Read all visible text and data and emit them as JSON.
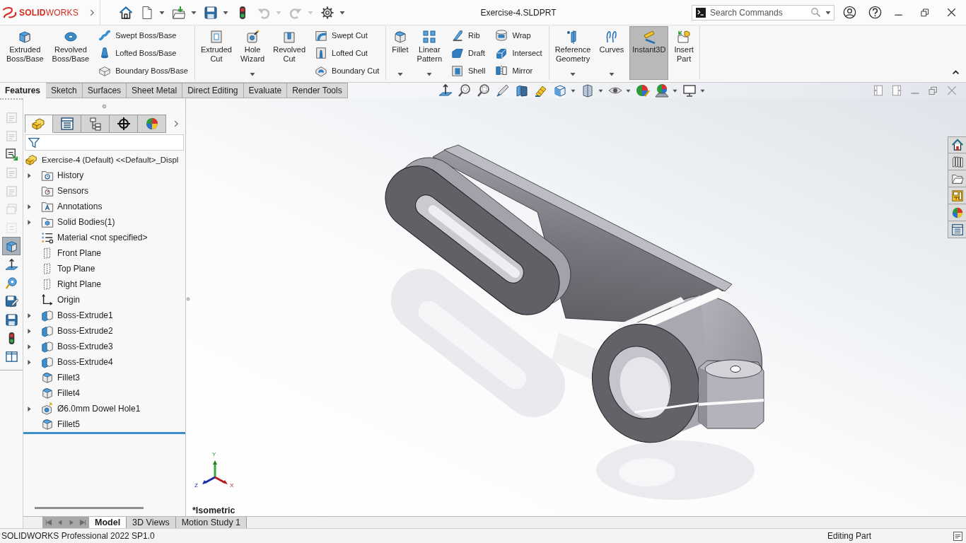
{
  "app": {
    "logo": "**SOLID**WORKS"
  },
  "quick_access": [
    {
      "dropdown": false,
      "disabled": false
    },
    {
      "dropdown": true,
      "disabled": false
    },
    {
      "dropdown": true,
      "disabled": false
    },
    {
      "dropdown": true,
      "disabled": false
    },
    {
      "dropdown": false,
      "disabled": false
    },
    {
      "dropdown": true,
      "disabled": true
    },
    {
      "dropdown": true,
      "disabled": true
    },
    {
      "dropdown": true,
      "disabled": false
    }
  ],
  "window": {
    "title": "Exercise-4.SLDPRT"
  },
  "search": {
    "placeholder": "Search Commands"
  },
  "ribbon": {
    "groups": [
      {
        "items": [
          {
            "kind": "large",
            "label": "Extruded Boss/Base",
            "dropdown": false,
            "selected": false
          },
          {
            "kind": "large",
            "label": "Revolved Boss/Base",
            "dropdown": false,
            "selected": false
          },
          {
            "kind": "column",
            "items": [
              {
                "label": "Swept Boss/Base"
              },
              {
                "label": "Lofted Boss/Base"
              },
              {
                "label": "Boundary Boss/Base"
              }
            ]
          }
        ]
      },
      {
        "items": [
          {
            "kind": "large",
            "label": "Extruded Cut",
            "dropdown": false,
            "selected": false
          },
          {
            "kind": "large",
            "label": "Hole Wizard",
            "dropdown": true,
            "selected": false
          },
          {
            "kind": "large",
            "label": "Revolved Cut",
            "dropdown": false,
            "selected": false
          },
          {
            "kind": "column",
            "items": [
              {
                "label": "Swept Cut"
              },
              {
                "label": "Lofted Cut"
              },
              {
                "label": "Boundary Cut"
              }
            ]
          }
        ]
      },
      {
        "items": [
          {
            "kind": "large",
            "label": "Fillet",
            "dropdown": true,
            "selected": false
          },
          {
            "kind": "large",
            "label": "Linear Pattern",
            "dropdown": true,
            "selected": false
          },
          {
            "kind": "column",
            "items": [
              {
                "label": "Rib"
              },
              {
                "label": "Draft"
              },
              {
                "label": "Shell"
              }
            ]
          },
          {
            "kind": "column",
            "items": [
              {
                "label": "Wrap"
              },
              {
                "label": "Intersect"
              },
              {
                "label": "Mirror"
              }
            ]
          }
        ]
      },
      {
        "items": [
          {
            "kind": "large",
            "label": "Reference Geometry",
            "dropdown": true,
            "selected": false
          },
          {
            "kind": "large",
            "label": "Curves",
            "dropdown": true,
            "selected": false
          },
          {
            "kind": "large",
            "label": "Instant3D",
            "dropdown": false,
            "selected": true
          },
          {
            "kind": "large",
            "label": "Insert Part",
            "dropdown": false,
            "selected": false
          }
        ]
      }
    ]
  },
  "command_tabs": [
    {
      "label": "Features",
      "selected": true
    },
    {
      "label": "Sketch",
      "selected": false
    },
    {
      "label": "Surfaces",
      "selected": false
    },
    {
      "label": "Sheet Metal",
      "selected": false
    },
    {
      "label": "Direct Editing",
      "selected": false
    },
    {
      "label": "Evaluate",
      "selected": false
    },
    {
      "label": "Render Tools",
      "selected": false
    }
  ],
  "heads_up_toolbar": [
    {
      "dropdown": false
    },
    {
      "dropdown": false
    },
    {
      "dropdown": false
    },
    {
      "dropdown": false
    },
    {
      "dropdown": false
    },
    {
      "dropdown": false
    },
    {
      "dropdown": true
    },
    {
      "dropdown": true
    },
    {
      "dropdown": true
    },
    {
      "dropdown": false
    },
    {
      "dropdown": true
    },
    {
      "dropdown": true
    }
  ],
  "left_toolbar": [
    {
      "disabled": true,
      "selected": false
    },
    {
      "disabled": true,
      "selected": false
    },
    {
      "disabled": false,
      "selected": false
    },
    {
      "disabled": true,
      "selected": false
    },
    {
      "disabled": true,
      "selected": false
    },
    {
      "disabled": true,
      "selected": false
    },
    {
      "disabled": true,
      "selected": false
    },
    {
      "disabled": false,
      "selected": true
    },
    {
      "disabled": false,
      "selected": false
    },
    {
      "disabled": false,
      "selected": false
    },
    {
      "disabled": false,
      "selected": false
    },
    {
      "disabled": false,
      "selected": false
    },
    {
      "disabled": false,
      "selected": false
    },
    {
      "disabled": false,
      "selected": false
    }
  ],
  "feature_manager": {
    "tabs": [
      {
        "selected": true
      },
      {
        "selected": false
      },
      {
        "selected": false
      },
      {
        "selected": false
      },
      {
        "selected": false
      }
    ],
    "tree": {
      "label": "Exercise-4 (Default) <<Default>_Displ",
      "kind": "part",
      "children": [
        {
          "label": "History",
          "kind": "history",
          "expanded": false
        },
        {
          "label": "Sensors",
          "kind": "sensors"
        },
        {
          "label": "Annotations",
          "kind": "annotations",
          "expanded": false
        },
        {
          "label": "Solid Bodies(1)",
          "kind": "bodies",
          "expanded": false
        },
        {
          "label": "Material <not specified>",
          "kind": "material"
        },
        {
          "label": "Front Plane",
          "kind": "plane"
        },
        {
          "label": "Top Plane",
          "kind": "plane"
        },
        {
          "label": "Right Plane",
          "kind": "plane"
        },
        {
          "label": "Origin",
          "kind": "origin"
        },
        {
          "label": "Boss-Extrude1",
          "kind": "extrude",
          "expanded": false
        },
        {
          "label": "Boss-Extrude2",
          "kind": "extrude",
          "expanded": false
        },
        {
          "label": "Boss-Extrude3",
          "kind": "extrude",
          "expanded": false
        },
        {
          "label": "Boss-Extrude4",
          "kind": "extrude",
          "expanded": false
        },
        {
          "label": "Fillet3",
          "kind": "fillet"
        },
        {
          "label": "Fillet4",
          "kind": "fillet"
        },
        {
          "label": "Ø6.0mm Dowel Hole1",
          "kind": "hole",
          "expanded": false
        },
        {
          "label": "Fillet5",
          "kind": "fillet"
        }
      ]
    }
  },
  "viewport": {
    "view_label": "*Isometric",
    "triad": {
      "x": "X",
      "y": "Y",
      "z": "Z"
    }
  },
  "bottom_tabs": [
    {
      "label": "Model",
      "selected": true
    },
    {
      "label": "3D Views",
      "selected": false
    },
    {
      "label": "Motion Study 1",
      "selected": false
    }
  ],
  "status_bar": {
    "product": "SOLIDWORKS Professional 2022 SP1.0",
    "mode": "Editing Part"
  }
}
